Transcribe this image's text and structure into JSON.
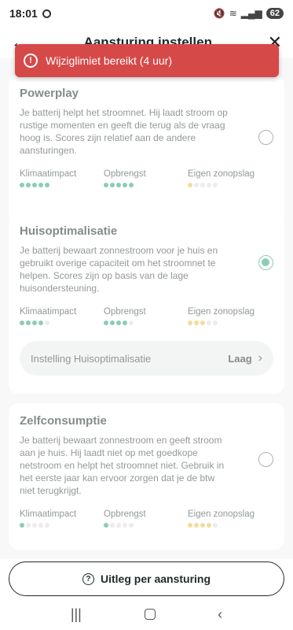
{
  "status_bar": {
    "time": "18:01",
    "battery": "62"
  },
  "header": {
    "title": "Aansturing instellen"
  },
  "toast": {
    "message": "Wijziglimiet bereikt (4 uur)",
    "color": "#d64949"
  },
  "metric_labels": {
    "climate": "Klimaatimpact",
    "revenue": "Opbrengst",
    "self": "Eigen zonopslag"
  },
  "options": [
    {
      "title": "Powerplay",
      "description": "Je batterij helpt het stroomnet. Hij laadt stroom op rustige momenten en geeft die terug als de vraag hoog is. Scores zijn relatief aan de andere aansturingen.",
      "selected": false,
      "scores": {
        "climate": 5,
        "revenue": 5,
        "self": 1
      }
    },
    {
      "title": "Huisoptimalisatie",
      "description": "Je batterij bewaart zonnestroom voor je huis en gebruikt overige capaciteit om het stroomnet te helpen. Scores zijn op basis van de lage huisondersteuning.",
      "selected": true,
      "scores": {
        "climate": 4,
        "revenue": 4,
        "self": 3
      },
      "setting_label": "Instelling Huisoptimalisatie",
      "setting_value": "Laag"
    },
    {
      "title": "Zelfconsumptie",
      "description": "Je batterij bewaart zonnestroom en geeft stroom aan je huis. Hij laadt niet op met goedkope netstroom en helpt het stroomnet niet. Gebruik in het eerste jaar kan ervoor zorgen dat je de btw niet terugkrijgt.",
      "selected": false,
      "scores": {
        "climate": 1,
        "revenue": 1,
        "self": 4
      }
    }
  ],
  "bottom_button": {
    "label": "Uitleg per aansturing"
  },
  "colors": {
    "accent": "#2fa27c",
    "self_dot": "#e9c04a"
  }
}
